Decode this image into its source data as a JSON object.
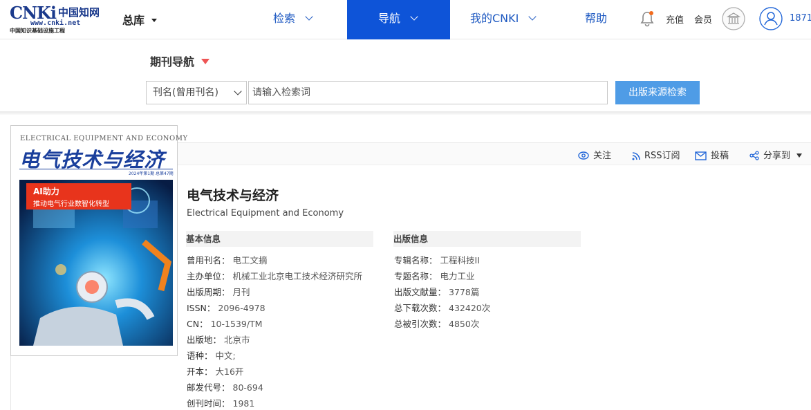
{
  "header": {
    "logo_big": "CNKi",
    "logo_cn": "中国知网",
    "logo_url": "www.cnki.net",
    "logo_sub": "中国知识基础设施工程",
    "library_label": "总库",
    "nav": [
      {
        "label": "检索",
        "active": false
      },
      {
        "label": "导航",
        "active": true
      },
      {
        "label": "我的CNKI",
        "active": false
      },
      {
        "label": "帮助",
        "active": false
      }
    ],
    "recharge": "充值",
    "member": "会员",
    "username": "1871"
  },
  "search": {
    "section_title": "期刊导航",
    "field_select": "刊名(曾用刊名)",
    "placeholder": "请输入检索词",
    "button": "出版来源检索"
  },
  "toolbar": {
    "follow": "关注",
    "rss": "RSS订阅",
    "submit": "投稿",
    "share": "分享到"
  },
  "cover": {
    "en_title": "ELECTRICAL EQUIPMENT AND ECONOMY",
    "cn_title": "电气技术与经济",
    "issue_line": "2024年第1期 总第47期",
    "banner_a": "AI助力",
    "banner_b": "推动电气行业数智化转型"
  },
  "journal": {
    "title": "电气技术与经济",
    "en_title": "Electrical Equipment and Economy",
    "basic_head": "基本信息",
    "pub_head": "出版信息",
    "basic": [
      {
        "k": "曾用刊名：",
        "v": "电工文摘"
      },
      {
        "k": "主办单位：",
        "v": "机械工业北京电工技术经济研究所"
      },
      {
        "k": "出版周期：",
        "v": "月刊"
      },
      {
        "k": "ISSN：",
        "v": "2096-4978"
      },
      {
        "k": "CN：",
        "v": "10-1539/TM"
      },
      {
        "k": "出版地：",
        "v": "北京市"
      },
      {
        "k": "语种：",
        "v": "中文;"
      },
      {
        "k": "开本：",
        "v": "大16开"
      },
      {
        "k": "邮发代号：",
        "v": "80-694"
      },
      {
        "k": "创刊时间：",
        "v": "1981"
      }
    ],
    "pub": [
      {
        "k": "专辑名称：",
        "v": "工程科技II"
      },
      {
        "k": "专题名称：",
        "v": "电力工业"
      },
      {
        "k": "出版文献量：",
        "v": "3778篇"
      },
      {
        "k": "总下载次数：",
        "v": "432420次"
      },
      {
        "k": "总被引次数：",
        "v": "4850次"
      }
    ]
  }
}
